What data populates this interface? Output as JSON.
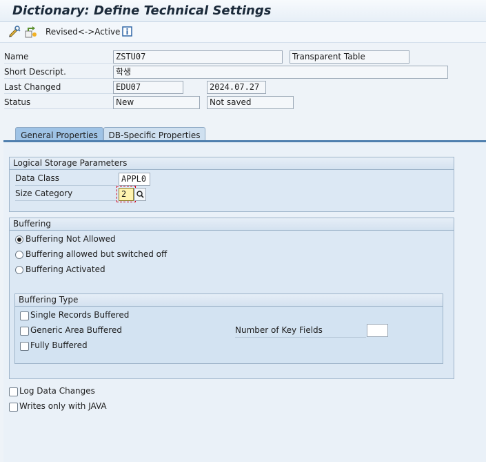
{
  "window": {
    "title": "Dictionary: Define Technical Settings"
  },
  "toolbar": {
    "revised_active_label": "Revised<->Active"
  },
  "header": {
    "name_label": "Name",
    "name_value": "ZSTU07",
    "object_type": "Transparent Table",
    "short_desc_label": "Short Descript.",
    "short_desc_value": "학생",
    "last_changed_label": "Last Changed",
    "last_changed_user": "EDU07",
    "last_changed_date": "2024.07.27",
    "status_label": "Status",
    "status_value": "New",
    "save_state": "Not saved"
  },
  "tabs": [
    {
      "label": "General Properties",
      "active": true
    },
    {
      "label": "DB-Specific Properties",
      "active": false
    }
  ],
  "logical_storage": {
    "title": "Logical Storage Parameters",
    "data_class_label": "Data Class",
    "data_class_value": "APPL0",
    "size_category_label": "Size Category",
    "size_category_value": "2"
  },
  "buffering": {
    "title": "Buffering",
    "options": [
      {
        "label": "Buffering Not Allowed",
        "selected": true
      },
      {
        "label": "Buffering allowed but switched off",
        "selected": false
      },
      {
        "label": "Buffering Activated",
        "selected": false
      }
    ]
  },
  "buffering_type": {
    "title": "Buffering Type",
    "options": [
      {
        "label": "Single Records Buffered",
        "checked": false
      },
      {
        "label": "Generic Area Buffered",
        "checked": false
      },
      {
        "label": "Fully Buffered",
        "checked": false
      }
    ],
    "key_fields_label": "Number of Key Fields",
    "key_fields_value": ""
  },
  "flags": [
    {
      "label": "Log Data Changes",
      "checked": false
    },
    {
      "label": "Writes only with JAVA",
      "checked": false
    }
  ],
  "colors": {
    "accent": "#4f7fae",
    "field_highlight": "#fff3b0",
    "required_marker": "#d0021b"
  }
}
